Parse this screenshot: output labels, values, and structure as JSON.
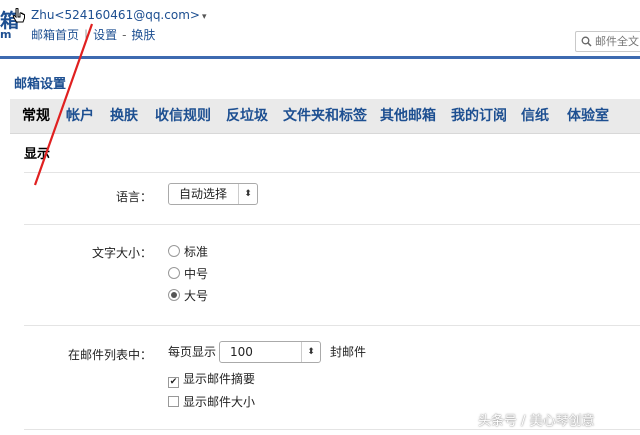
{
  "header": {
    "logo_char": "箱",
    "logo_sub": "m",
    "account": "Zhu<524160461@qq.com>",
    "account_caret": "▾",
    "links": {
      "home": "邮箱首页",
      "settings": "设置",
      "skin": "换肤"
    },
    "search": {
      "placeholder": "邮件全文"
    }
  },
  "page_title": "邮箱设置",
  "tabs": [
    {
      "label": "常规",
      "active": true
    },
    {
      "label": "帐户"
    },
    {
      "label": "换肤"
    },
    {
      "label": "收信规则"
    },
    {
      "label": "反垃圾"
    },
    {
      "label": "文件夹和标签"
    },
    {
      "label": "其他邮箱"
    },
    {
      "label": "我的订阅"
    },
    {
      "label": "信纸"
    },
    {
      "label": "体验室"
    }
  ],
  "section": {
    "title": "显示",
    "language": {
      "label": "语言：",
      "value": "自动选择"
    },
    "font_size": {
      "label": "文字大小：",
      "options": [
        "标准",
        "中号",
        "大号"
      ],
      "selected": "大号"
    },
    "mail_list": {
      "label": "在邮件列表中：",
      "per_page_prefix": "每页显示",
      "per_page_value": "100",
      "per_page_suffix": "封邮件",
      "show_summary": {
        "label": "显示邮件摘要",
        "checked": true
      },
      "show_size": {
        "label": "显示邮件大小",
        "checked": false
      }
    }
  },
  "annotation_color": "#e02020",
  "watermark": "头条号 / 美心琴创意"
}
